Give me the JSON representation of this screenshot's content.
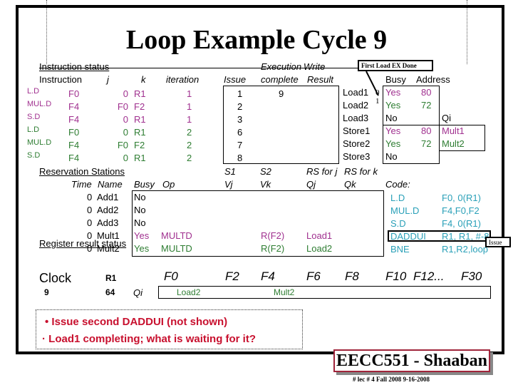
{
  "title": "Loop Example Cycle 9",
  "instruction_status": {
    "section_label": "Instruction status",
    "headers": {
      "instruction": "Instruction",
      "j": "j",
      "k": "k",
      "iteration": "iteration",
      "issue": "Issue",
      "exec_top": "Execution",
      "exec_bottom": "complete",
      "write_top": "Write",
      "write_bottom": "Result"
    },
    "rows": [
      {
        "op": "L.D",
        "dst": "F0",
        "j": "0",
        "k": "R1",
        "iteration": "1",
        "issue": "1",
        "exec": "9",
        "write": "",
        "color": "magenta"
      },
      {
        "op": "MUL.D",
        "dst": "F4",
        "j": "F0",
        "k": "F2",
        "iteration": "1",
        "issue": "2",
        "exec": "",
        "write": "",
        "color": "magenta"
      },
      {
        "op": "S.D",
        "dst": "F4",
        "j": "0",
        "k": "R1",
        "iteration": "1",
        "issue": "3",
        "exec": "",
        "write": "",
        "color": "magenta"
      },
      {
        "op": "L.D",
        "dst": "F0",
        "j": "0",
        "k": "R1",
        "iteration": "2",
        "issue": "6",
        "exec": "",
        "write": "",
        "color": "green"
      },
      {
        "op": "MUL.D",
        "dst": "F4",
        "j": "F0",
        "k": "F2",
        "iteration": "2",
        "issue": "7",
        "exec": "",
        "write": "",
        "color": "green"
      },
      {
        "op": "S.D",
        "dst": "F4",
        "j": "0",
        "k": "R1",
        "iteration": "2",
        "issue": "8",
        "exec": "",
        "write": "",
        "color": "green"
      }
    ]
  },
  "load_store_buffers": {
    "headers": {
      "busy": "Busy",
      "address": "Address",
      "qi": "Qi"
    },
    "rows": [
      {
        "name": "Load1",
        "marker": "0",
        "busy": "Yes",
        "address": "80",
        "qi": "",
        "color": "magenta"
      },
      {
        "name": "Load2",
        "marker": "1",
        "busy": "Yes",
        "address": "72",
        "qi": "",
        "color": "green"
      },
      {
        "name": "Load3",
        "marker": "",
        "busy": "No",
        "address": "",
        "qi": "",
        "color": "black"
      },
      {
        "name": "Store1",
        "marker": "",
        "busy": "Yes",
        "address": "80",
        "qi": "Mult1",
        "color": "magenta"
      },
      {
        "name": "Store2",
        "marker": "",
        "busy": "Yes",
        "address": "72",
        "qi": "Mult2",
        "color": "green"
      },
      {
        "name": "Store3",
        "marker": "",
        "busy": "No",
        "address": "",
        "qi": "",
        "color": "black"
      }
    ]
  },
  "callouts": {
    "first_load": "First Load EX Done",
    "issue": "Issue"
  },
  "reservation_stations": {
    "section_label": "Reservation Stations",
    "headers": {
      "time": "Time",
      "name": "Name",
      "busy": "Busy",
      "op": "Op",
      "s1": "S1",
      "vj": "Vj",
      "s2": "S2",
      "vk": "Vk",
      "rsj": "RS for j",
      "qj": "Qj",
      "rsk": "RS for k",
      "qk": "Qk"
    },
    "rows": [
      {
        "time": "0",
        "name": "Add1",
        "busy": "No",
        "op": "",
        "vj": "",
        "vk": "",
        "qj": "",
        "qk": "",
        "color": "black"
      },
      {
        "time": "0",
        "name": "Add2",
        "busy": "No",
        "op": "",
        "vj": "",
        "vk": "",
        "qj": "",
        "qk": "",
        "color": "black"
      },
      {
        "time": "0",
        "name": "Add3",
        "busy": "No",
        "op": "",
        "vj": "",
        "vk": "",
        "qj": "",
        "qk": "",
        "color": "black"
      },
      {
        "time": "0",
        "name": "Mult1",
        "busy": "Yes",
        "op": "MULTD",
        "vj": "",
        "vk": "R(F2)",
        "qj": "Load1",
        "qk": "",
        "color": "magenta"
      },
      {
        "time": "0",
        "name": "Mult2",
        "busy": "Yes",
        "op": "MULTD",
        "vj": "",
        "vk": "R(F2)",
        "qj": "Load2",
        "qk": "",
        "color": "green"
      }
    ]
  },
  "code": {
    "label": "Code:",
    "lines": [
      {
        "op": "L.D",
        "args": "F0, 0(R1)"
      },
      {
        "op": "MUL.D",
        "args": "F4,F0,F2"
      },
      {
        "op": "S.D",
        "args": "F4, 0(R1)"
      },
      {
        "op": "DADDUI",
        "args": "R1, R1, #-8"
      },
      {
        "op": "BNE",
        "args": "R1,R2,loop"
      }
    ]
  },
  "register_status": {
    "section_label": "Register result status",
    "clock_label": "Clock",
    "clock_value": "9",
    "r1_label": "R1",
    "r1_value": "64",
    "qi_label": "Qi",
    "registers": [
      "F0",
      "F2",
      "F4",
      "F6",
      "F8",
      "F10",
      "F12...",
      "F30"
    ],
    "values": [
      "Load2",
      "",
      "Mult2",
      "",
      "",
      "",
      "",
      ""
    ]
  },
  "notes": [
    "Issue second DADDUI (not shown)",
    "Load1 completing; what is waiting for it?"
  ],
  "footer": {
    "course": "EECC551 - Shaaban",
    "lecture": "#  lec # 4  Fall 2008     9-16-2008"
  },
  "colors": {
    "magenta": "#a0308f",
    "green": "#2e7d32",
    "cyan": "#2aa0b8",
    "red": "#c8102e",
    "footer_border": "#a0243a"
  }
}
